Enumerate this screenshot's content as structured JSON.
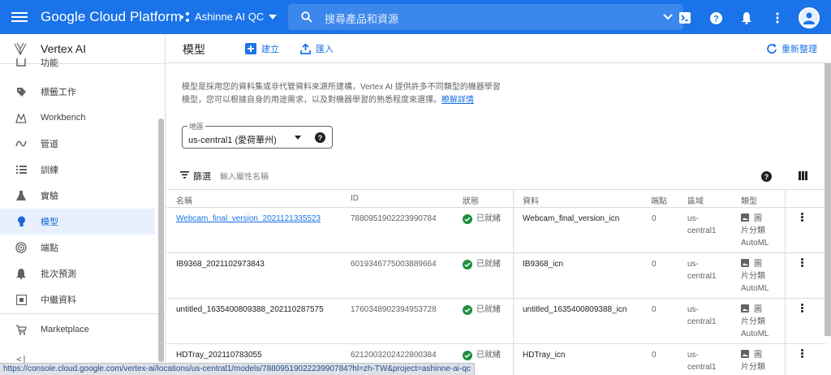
{
  "topbar": {
    "brand": "Google Cloud Platform",
    "project": "Ashinne AI QC",
    "search_placeholder": "搜尋產品和資源"
  },
  "sidebar": {
    "title": "Vertex AI",
    "items": [
      {
        "label": "功能",
        "icon": "features-icon"
      },
      {
        "label": "標籤工作",
        "icon": "label-tag-icon"
      },
      {
        "label": "Workbench",
        "icon": "workbench-icon"
      },
      {
        "label": "管道",
        "icon": "pipeline-icon"
      },
      {
        "label": "訓練",
        "icon": "training-list-icon"
      },
      {
        "label": "實驗",
        "icon": "experiment-flask-icon"
      },
      {
        "label": "模型",
        "icon": "model-bulb-icon",
        "active": true
      },
      {
        "label": "端點",
        "icon": "endpoint-icon"
      },
      {
        "label": "批次預測",
        "icon": "bell-icon"
      },
      {
        "label": "中繼資料",
        "icon": "metadata-icon"
      }
    ],
    "marketplace": "Marketplace",
    "collapse": "<|"
  },
  "main": {
    "title": "模型",
    "create": "建立",
    "import": "匯入",
    "refresh": "重新整理",
    "desc_line1": "模型是採用您的資料集或非代管資料來源所建構，Vertex AI 提供許多不同類型的機器學習",
    "desc_line2": "模型，您可以根據自身的用途需求，以及對機器學習的熟悉程度來選擇。",
    "learn_more": "瞭解詳情",
    "region_label": "地區",
    "region_value": "us-central1 (愛荷華州)",
    "filter_label": "篩選",
    "filter_placeholder": "輸入屬性名稱"
  },
  "table": {
    "headers": [
      "名稱",
      "ID",
      "狀態",
      "資料",
      "端點",
      "區域",
      "類型"
    ],
    "rows": [
      {
        "name": "Webcam_final_version_2021121335523",
        "id": "7880951902223990784",
        "status": "已就緒",
        "data": "Webcam_final_version_icn",
        "endpoint": "0",
        "region1": "us-",
        "region2": "central1",
        "type1": "圖",
        "type2": "片分類",
        "type3": "AutoML",
        "link": true
      },
      {
        "name": "IB9368_2021102973843",
        "id": "6019346775003889664",
        "status": "已就緒",
        "data": "IB9368_icn",
        "endpoint": "0",
        "region1": "us-",
        "region2": "central1",
        "type1": "圖",
        "type2": "片分類",
        "type3": "AutoML",
        "link": false
      },
      {
        "name": "untitled_1635400809388_202110287575",
        "id": "1760348902394953728",
        "status": "已就緒",
        "data": "untitled_1635400809388_icn",
        "endpoint": "0",
        "region1": "us-",
        "region2": "central1",
        "type1": "圖",
        "type2": "片分類",
        "type3": "AutoML",
        "link": false
      },
      {
        "name": "HDTray_202110783055",
        "id": "6212003202422800384",
        "status": "已就緒",
        "data": "HDTray_icn",
        "endpoint": "0",
        "region1": "us-",
        "region2": "central1",
        "type1": "圖",
        "type2": "片分類",
        "type3": "",
        "link": false
      }
    ]
  },
  "statusbar": {
    "url": "https://console.cloud.google.com/vertex-ai/locations/us-central1/models/7880951902223990784?hl=zh-TW&project=ashinne-ai-qc"
  },
  "colors": {
    "topbar": "#1a73e8",
    "active_bg": "#e8f0fe",
    "ready_green": "#1e8e3e"
  }
}
